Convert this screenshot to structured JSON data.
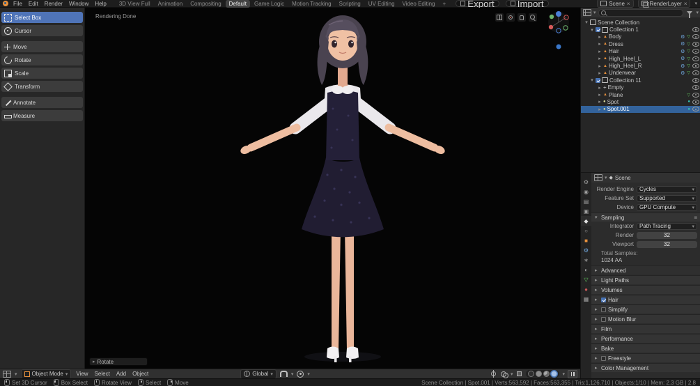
{
  "icons": {
    "disclosure_open": "▾",
    "disclosure_closed": "▸",
    "dropdown_caret": "▾",
    "close": "×",
    "menu": "≡"
  },
  "colors": {
    "accent_blue": "#4772b3",
    "selection_blue": "#33639c",
    "active_tool_blue": "#4f74b8",
    "object_orange": "#e8913d",
    "mesh_data_green": "#62c75f",
    "modifier_blue": "#71a8e0"
  },
  "topbar": {
    "menus": [
      "File",
      "Edit",
      "Render",
      "Window",
      "Help"
    ],
    "workspaces": [
      "3D View Full",
      "Animation",
      "Compositing",
      "Default",
      "Game Logic",
      "Motion Tracking",
      "Scripting",
      "UV Editing",
      "Video Editing",
      "+"
    ],
    "active_workspace": "Default",
    "export_button": "Export",
    "import_button": "Import",
    "scene_name": "Scene",
    "view_layer_name": "RenderLayer"
  },
  "toolbar": {
    "tools": [
      "Select Box",
      "Cursor",
      "Move",
      "Rotate",
      "Scale",
      "Transform",
      "Annotate",
      "Measure"
    ],
    "active_tool": "Select Box"
  },
  "viewport": {
    "status_text": "Rendering Done",
    "operator_panel_label": "Rotate"
  },
  "viewport_header": {
    "mode": "Object Mode",
    "menus": [
      "View",
      "Select",
      "Add",
      "Object"
    ],
    "orientation": "Global"
  },
  "outliner": {
    "root_label": "Scene Collection",
    "rows": [
      {
        "name": "Collection 1",
        "type": "collection",
        "checked": true
      },
      {
        "name": "Body",
        "type": "mesh"
      },
      {
        "name": "Dress",
        "type": "mesh"
      },
      {
        "name": "Hair",
        "type": "mesh"
      },
      {
        "name": "High_Heel_L",
        "type": "mesh"
      },
      {
        "name": "High_Heel_R",
        "type": "mesh"
      },
      {
        "name": "Underwear",
        "type": "mesh"
      },
      {
        "name": "Collection 11",
        "type": "collection",
        "checked": true
      },
      {
        "name": "Empty",
        "type": "empty"
      },
      {
        "name": "Plane",
        "type": "mesh"
      },
      {
        "name": "Spot",
        "type": "light"
      },
      {
        "name": "Spot.001",
        "type": "light",
        "selected": true
      }
    ]
  },
  "properties": {
    "breadcrumb": "Scene",
    "rows": [
      {
        "label": "Render Engine",
        "value": "Cycles"
      },
      {
        "label": "Feature Set",
        "value": "Supported"
      },
      {
        "label": "Device",
        "value": "GPU Compute"
      }
    ],
    "sampling": {
      "title": "Sampling",
      "integrator_label": "Integrator",
      "integrator_value": "Path Tracing",
      "render_label": "Render",
      "render_value": "32",
      "viewport_label": "Viewport",
      "viewport_value": "32",
      "total_samples_label": "Total Samples:",
      "total_samples_value": "1024 AA",
      "advanced_label": "Advanced"
    },
    "panels": [
      {
        "label": "Light Paths"
      },
      {
        "label": "Volumes"
      },
      {
        "label": "Hair",
        "checkbox": "checked"
      },
      {
        "label": "Simplify",
        "checkbox": "unchecked"
      },
      {
        "label": "Motion Blur",
        "checkbox": "unchecked"
      },
      {
        "label": "Film"
      },
      {
        "label": "Performance"
      },
      {
        "label": "Bake"
      },
      {
        "label": "Freestyle",
        "checkbox": "unchecked"
      },
      {
        "label": "Color Management"
      }
    ],
    "tabs": [
      {
        "name": "tool",
        "glyph": "⚙"
      },
      {
        "name": "render",
        "glyph": "◉"
      },
      {
        "name": "output",
        "glyph": "▤"
      },
      {
        "name": "view-layer",
        "glyph": "▣"
      },
      {
        "name": "scene",
        "glyph": "◆"
      },
      {
        "name": "world",
        "glyph": "○"
      },
      {
        "name": "object",
        "glyph": "■"
      },
      {
        "name": "modifiers",
        "glyph": "⚙"
      },
      {
        "name": "particles",
        "glyph": "∗"
      },
      {
        "name": "physics",
        "glyph": "◐"
      },
      {
        "name": "object-data",
        "glyph": "▽"
      },
      {
        "name": "material",
        "glyph": "●"
      },
      {
        "name": "texture",
        "glyph": "▦"
      }
    ]
  },
  "statusbar": {
    "hints": [
      "Set 3D Cursor",
      "Box Select",
      "Rotate View",
      "Select",
      "Move"
    ],
    "stats": "Scene Collection | Spot.001 | Verts:563,592 | Faces:563,355 | Tris:1,126,710 | Objects:1/10 | Mem: 2.3 GB | 2.8"
  }
}
